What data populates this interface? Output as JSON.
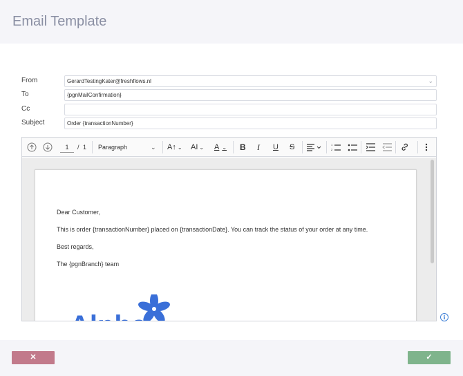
{
  "header": {
    "title": "Email Template"
  },
  "form": {
    "from": {
      "label": "From",
      "value": "GerardTestingKater@freshflows.nl"
    },
    "to": {
      "label": "To",
      "value": "{pgnMailConfirmation}"
    },
    "cc": {
      "label": "Cc",
      "value": ""
    },
    "subject": {
      "label": "Subject",
      "value": "Order {transactionNumber}"
    }
  },
  "toolbar": {
    "page_current": "1",
    "page_sep": "/",
    "page_total": "1",
    "paragraph_style": "Paragraph"
  },
  "document": {
    "lines": [
      "Dear Customer,",
      "This is order {transactionNumber} placed on {transactionDate}. You can track the status of your order at any time.",
      "Best regards,",
      "The  {pgnBranch} team"
    ],
    "logo_text": "Alpha"
  },
  "footer": {
    "cancel_label": "✕",
    "confirm_label": "✓"
  },
  "colors": {
    "cancel": "#c27a8b",
    "confirm": "#7fb48c",
    "logo": "#3a6fd8"
  }
}
